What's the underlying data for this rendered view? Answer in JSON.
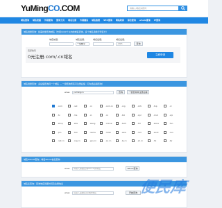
{
  "logo": {
    "main": "YuMing",
    "accent": "CO",
    "suffix": ".COM"
  },
  "search": {
    "placeholder": "请输入域名关键词"
  },
  "nav": [
    "域名查询",
    "域名批量",
    "外链查询",
    "查询工具",
    "域名注册",
    "外链建设",
    "域名备案",
    "SEO查询",
    "网站收录",
    "综合查询",
    "whois查询",
    "IP查询"
  ],
  "panel1": {
    "title": "域名批量查询：如需批量查询域名（支持1000个以内的域名查询，多个域名用换行符区分）",
    "labels": [
      "域名前缀：",
      "域名后缀：",
      "域名后缀：",
      "域名后缀："
    ],
    "selects": [
      "一位数字",
      ".com"
    ],
    "button": "查询"
  },
  "ad": {
    "brand": "西部数码",
    "title": "0元注册.com/.cn域名",
    "button": "立即申请"
  },
  "panel2": {
    "title": "域名批量查询：多后缀查询同一个域名 — 一键查询所有可注册后缀（可勾选后缀查询）",
    "prefix": "www.",
    "value": "yumingco",
    "query_button": "查询",
    "register_button": "一键查询未注册后缀",
    "tlds": [
      [
        ".com",
        ".net",
        ".cn",
        ".com.cn",
        ".org",
        ".info",
        ".top",
        ".cc"
      ],
      [
        ".tv",
        ".me",
        ".io",
        ".co",
        ".biz",
        ".xyz",
        ".club",
        ".vip"
      ],
      [
        ".shop",
        ".site",
        ".wang",
        ".online",
        ".tech",
        ".ltd",
        ".store",
        ".fun"
      ],
      [
        ".pro",
        ".link",
        ".name",
        ".mobi",
        ".asia",
        ".red",
        ".work",
        ".ren"
      ],
      [
        ".net.cn",
        ".org.cn",
        ".gov.cn",
        ".ac.cn",
        ".bj.cn",
        ".sh.cn",
        ".hk",
        ".tw"
      ]
    ],
    "checked": ".com"
  },
  "panel3": {
    "title": "域名WHOIS查询：域名Whois信息查询",
    "prefix": "www.",
    "placeholder": "请输入需要查询Whois的域名",
    "button": "Whois查询"
  },
  "panel4": {
    "title": "域名反查询：查询域名到期时间及注册信息",
    "prefix": "www.",
    "placeholder": "请输入需要反查询的域名",
    "button": "开始查询"
  },
  "watermark": "便民库"
}
